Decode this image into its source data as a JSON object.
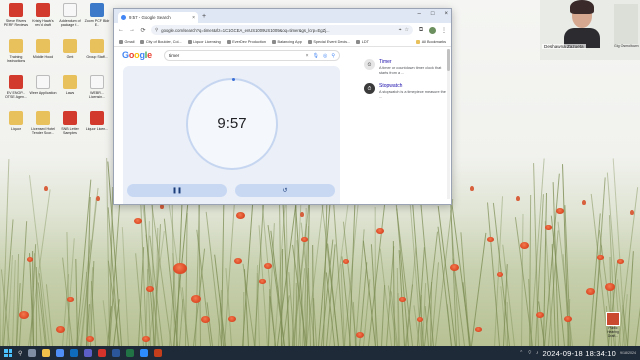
{
  "browser": {
    "tab_title": "9:57 - Google Search",
    "url": "google.com/search?q=timer&rlz=1C1GCEA_enUS1009US1009&oq=timer&gs_lcrp=EgZj...",
    "bookmarks": [
      {
        "label": "Gmail"
      },
      {
        "label": "City of Boulder, Col..."
      },
      {
        "label": "Liquor Licensing"
      },
      {
        "label": "EverDev Production"
      },
      {
        "label": "Balancing App"
      },
      {
        "label": "Special Event Decis..."
      },
      {
        "label": "LDT"
      }
    ],
    "all_bookmarks": "All Bookmarks"
  },
  "search": {
    "logo": "Google",
    "query": "timer"
  },
  "timer": {
    "display": "9:57",
    "pause_icon": "pause-icon",
    "reset_icon": "reset-icon"
  },
  "side_panel": {
    "items": [
      {
        "title": "Timer",
        "desc": "A timer or countdown timer clock that starts from a ..."
      },
      {
        "title": "Stopwatch",
        "desc": "A stopwatch is a timepiece measure the ..."
      }
    ]
  },
  "desktop_icons": [
    {
      "label": "Steve Rivers PERF Reviews",
      "icon": "pdf"
    },
    {
      "label": "Kristy Hawk's rev'd draft",
      "icon": "pdf"
    },
    {
      "label": "Addendum of package f...",
      "icon": "doc"
    },
    {
      "label": "Zoom PCF Bldr E..",
      "icon": "app"
    },
    {
      "label": "Training Instructions",
      "icon": "folder"
    },
    {
      "label": "Middle Hood",
      "icon": "folder"
    },
    {
      "label": "Gmt",
      "icon": "folder"
    },
    {
      "label": "Group Staff...",
      "icon": "folder"
    },
    {
      "label": "EV ENOP... OTSE Agen...",
      "icon": "pdf"
    },
    {
      "label": "Weer Application",
      "icon": "doc"
    },
    {
      "label": "Laws",
      "icon": "folder"
    },
    {
      "label": "WEBR... Licensin...",
      "icon": "doc"
    },
    {
      "label": "Liquor",
      "icon": "folder"
    },
    {
      "label": "Licensed Hotel Tender Scor...",
      "icon": "folder"
    },
    {
      "label": "SNB Letter Samples",
      "icon": "pdf"
    },
    {
      "label": "Liquor Licen...",
      "icon": "pdf"
    }
  ],
  "webcam": {
    "name": "Deshawna Zazueta",
    "tile_name": "Gig Osmoltown"
  },
  "badge": {
    "label": "Public Hearing Draft..."
  },
  "taskbar": {
    "clock": "2024-09-18  18:34:10",
    "clock_sub": "9/18/2024",
    "icons": [
      "search",
      "task-view",
      "file-explorer",
      "chrome",
      "outlook",
      "teams",
      "acrobat",
      "word",
      "excel",
      "zoom",
      "powerpoint"
    ]
  },
  "colors": {
    "google_blue": "#4285f4",
    "google_red": "#ea4335",
    "google_yellow": "#fbbc05",
    "google_green": "#34a853",
    "timer_card": "#eaeff8",
    "taskbar": "#1e2a38"
  }
}
